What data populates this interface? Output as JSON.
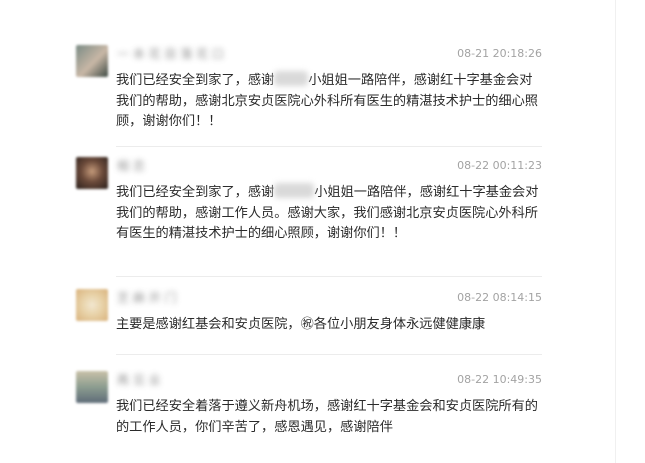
{
  "comments": [
    {
      "username": "一 本 花 目 落 花 口",
      "timestamp": "08-21 20:18:26",
      "content_before": "我们已经安全到家了，感谢",
      "content_after": "小姐姐一路陪伴，感谢红十字基金会对我们的帮助，感谢北京安贞医院心外科所有医生的精湛技术护士的细心照顾，谢谢你们！！",
      "avatar_colors": [
        "#7a8b84",
        "#c8b7a6",
        "#3d4a44"
      ]
    },
    {
      "username": "相 恋",
      "timestamp": "08-22 00:11:23",
      "content_before": "我们已经安全到家了，感谢",
      "content_after": "小姐姐一路陪伴，感谢红十字基金会对我们的帮助，感谢工作人员。感谢大家，我们感谢北京安贞医院心外科所有医生的精湛技术护士的细心照顾，谢谢你们！！",
      "avatar_colors": [
        "#6b4a3a",
        "#c49a7a",
        "#2a1f1b"
      ]
    },
    {
      "username": "芝 麻 开 门",
      "timestamp": "08-22 08:14:15",
      "content": "主要是感谢红基会和安贞医院，㊗各位小朋友身体永远健健康康",
      "avatar_colors": [
        "#e8d2a8",
        "#d9b27c",
        "#f2e7d0"
      ]
    },
    {
      "username": "再 见 业",
      "timestamp": "08-22 10:49:35",
      "content": "我们已经安全着落于遵义新舟机场，感谢红十字基金会和安贞医院所有的的工作人员，你们辛苦了，感恩遇见，感谢陪伴",
      "avatar_colors": [
        "#8c9d90",
        "#5e6b78",
        "#c9c1a8"
      ]
    }
  ]
}
